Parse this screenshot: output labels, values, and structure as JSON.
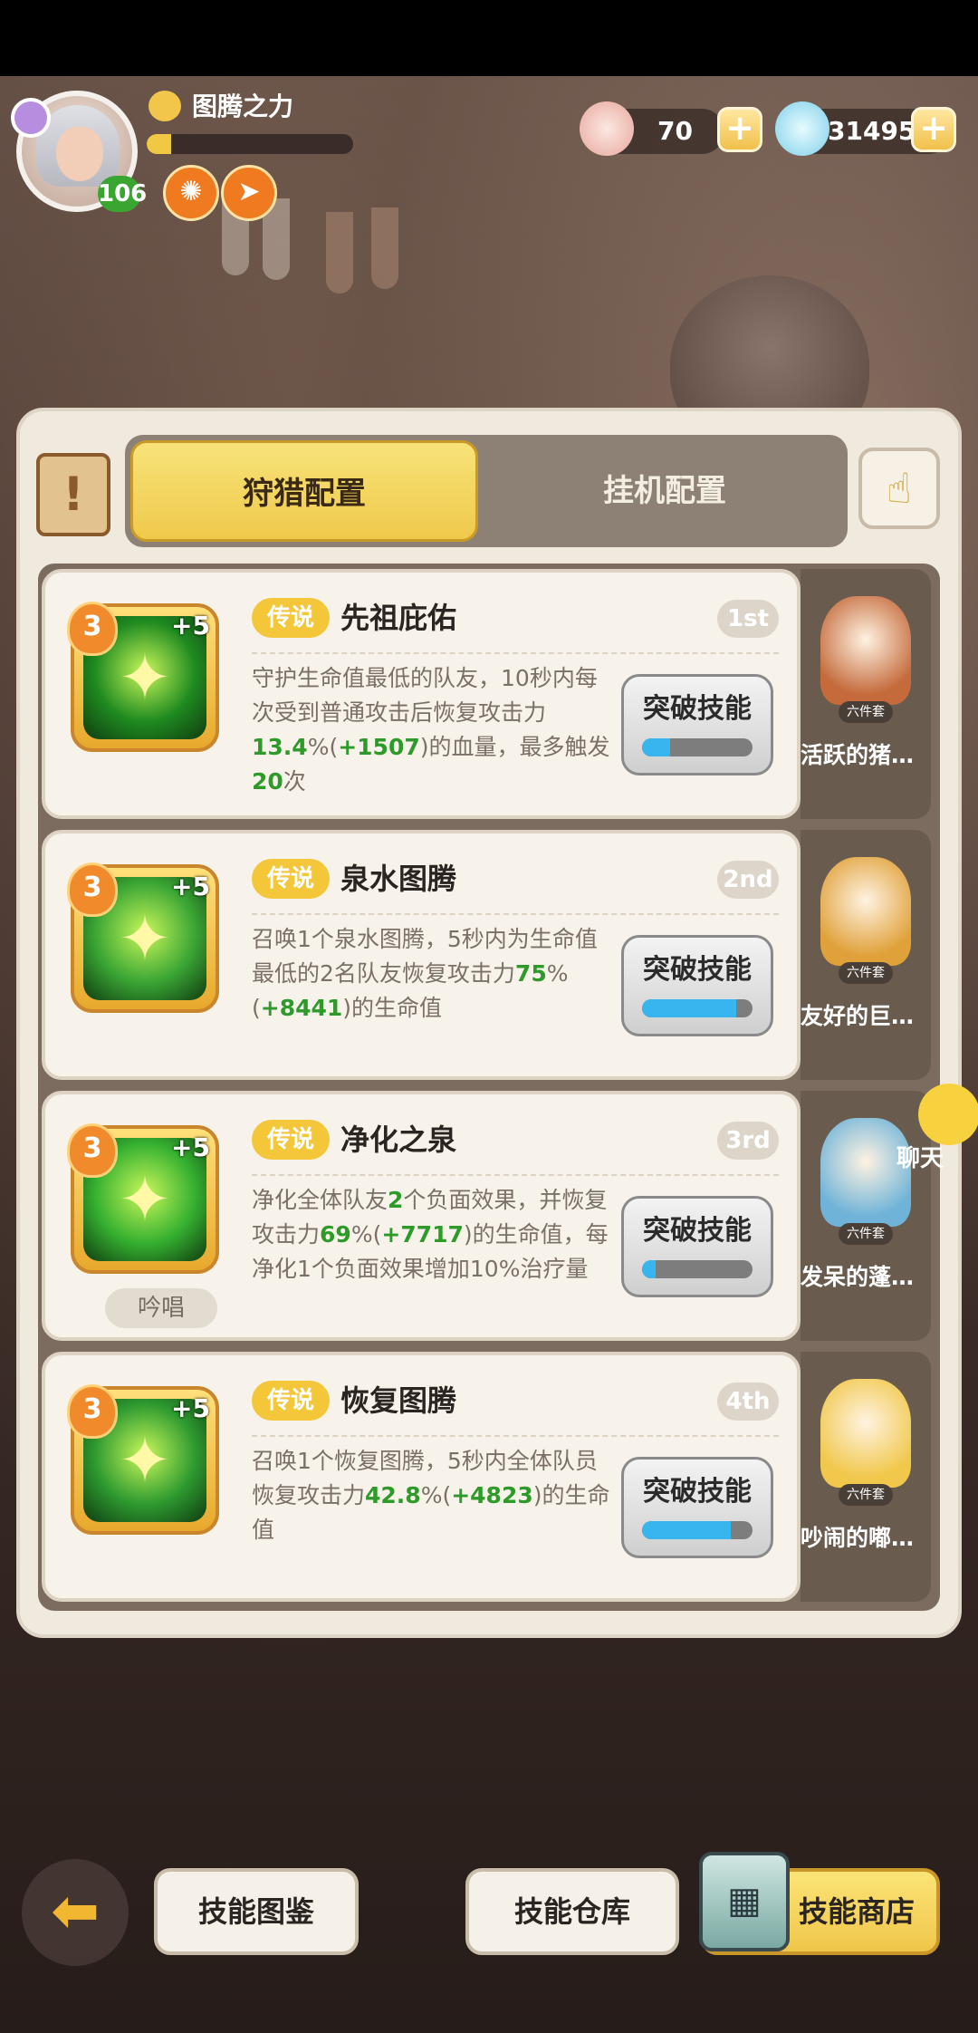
{
  "header": {
    "player_level": "106",
    "title_text": "图腾之力",
    "exp_fraction": 0.12,
    "buff_icons": [
      "orange-gear-buff-icon",
      "orange-bolt-buff-icon"
    ],
    "resources": [
      {
        "icon": "shell-currency-icon",
        "value": "70"
      },
      {
        "icon": "diamond-currency-icon",
        "value": "314954"
      }
    ]
  },
  "tabs": {
    "hunt": "狩猎配置",
    "idle": "挂机配置",
    "active": "hunt"
  },
  "skills": [
    {
      "level": "3",
      "plus": "+5",
      "rarity": "传说",
      "name": "先祖庇佑",
      "rank": "1st",
      "desc": [
        {
          "t": "守护生命值最低的队友，10秒内每次受到普通攻击后恢复攻击力"
        },
        {
          "t": "13.4",
          "hl": true
        },
        {
          "t": "%("
        },
        {
          "t": "+1507",
          "hl": true
        },
        {
          "t": ")的血量，最多触发"
        },
        {
          "t": "20",
          "hl": true
        },
        {
          "t": "次"
        }
      ],
      "break_label": "突破技能",
      "break_progress": 0.25,
      "set_name": "活跃的猪…",
      "set_tag": "六件套",
      "icon_color": "#1f8a20"
    },
    {
      "level": "3",
      "plus": "+5",
      "rarity": "传说",
      "name": "泉水图腾",
      "rank": "2nd",
      "desc": [
        {
          "t": "召唤1个泉水图腾，5秒内为生命值最低的2名队友恢复攻击力"
        },
        {
          "t": "75",
          "hl": true
        },
        {
          "t": "%("
        },
        {
          "t": "+8441",
          "hl": true
        },
        {
          "t": ")的生命值"
        }
      ],
      "break_label": "突破技能",
      "break_progress": 0.85,
      "set_name": "友好的巨…",
      "set_tag": "六件套",
      "icon_color": "#3aa534"
    },
    {
      "level": "3",
      "plus": "+5",
      "rarity": "传说",
      "name": "净化之泉",
      "rank": "3rd",
      "desc": [
        {
          "t": "净化全体队友"
        },
        {
          "t": "2",
          "hl": true
        },
        {
          "t": "个负面效果，并恢复攻击力"
        },
        {
          "t": "69",
          "hl": true
        },
        {
          "t": "%("
        },
        {
          "t": "+7717",
          "hl": true
        },
        {
          "t": ")的生命值，每净化1个负面效果增加10%治疗量"
        }
      ],
      "chant": "吟唱",
      "break_label": "突破技能",
      "break_progress": 0.12,
      "set_name": "发呆的蓬…",
      "set_tag": "六件套",
      "icon_color": "#35b030"
    },
    {
      "level": "3",
      "plus": "+5",
      "rarity": "传说",
      "name": "恢复图腾",
      "rank": "4th",
      "desc": [
        {
          "t": "召唤1个恢复图腾，5秒内全体队员恢复攻击力"
        },
        {
          "t": "42.8",
          "hl": true
        },
        {
          "t": "%("
        },
        {
          "t": "+4823",
          "hl": true
        },
        {
          "t": ")的生命值"
        }
      ],
      "break_label": "突破技能",
      "break_progress": 0.8,
      "set_name": "吵闹的嘟…",
      "set_tag": "六件套",
      "icon_color": "#2e9a30"
    }
  ],
  "chat": {
    "label": "聊天"
  },
  "bottom": {
    "codex": "技能图鉴",
    "warehouse": "技能仓库",
    "shop": "技能商店"
  }
}
